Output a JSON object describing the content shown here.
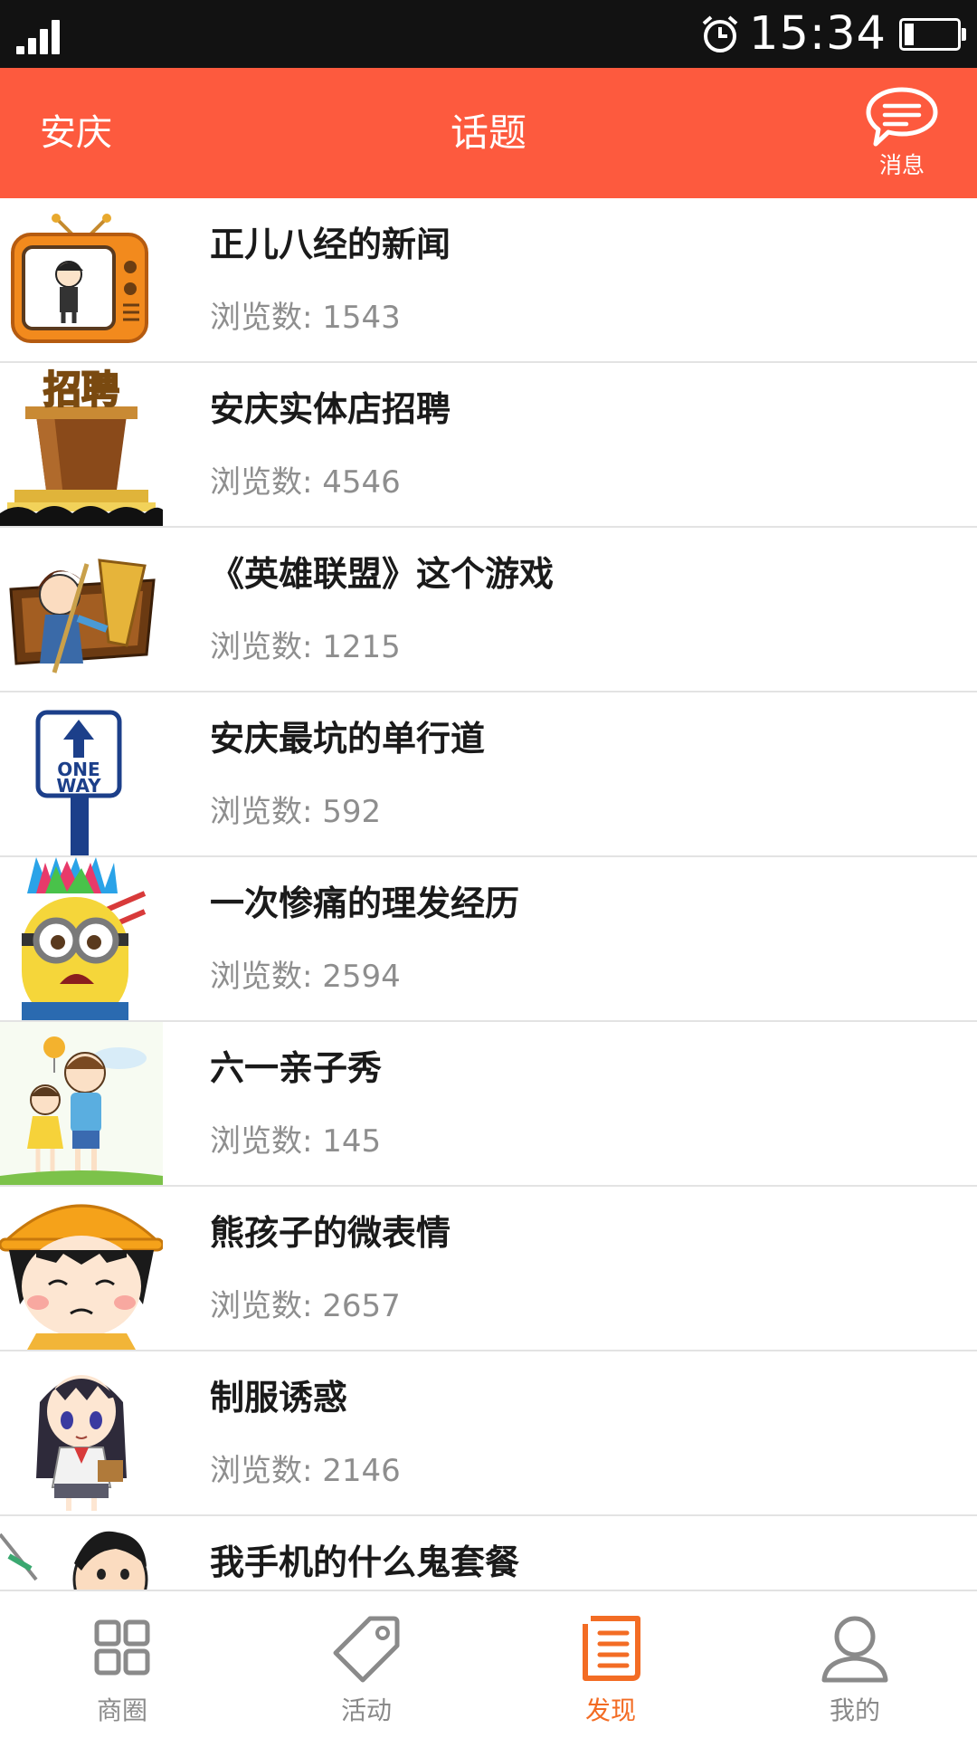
{
  "status_bar": {
    "time": "15:34"
  },
  "header": {
    "city": "安庆",
    "title": "话题",
    "message_label": "消息"
  },
  "topics": [
    {
      "title": "正儿八经的新闻",
      "views_label": "浏览数:",
      "views": "1543",
      "icon": "tv-cartoon-icon"
    },
    {
      "title": "安庆实体店招聘",
      "views_label": "浏览数:",
      "views": "4546",
      "icon": "recruit-podium-icon"
    },
    {
      "title": "《英雄联盟》这个游戏",
      "views_label": "浏览数:",
      "views": "1215",
      "icon": "game-hero-icon"
    },
    {
      "title": "安庆最坑的单行道",
      "views_label": "浏览数:",
      "views": "592",
      "icon": "one-way-sign-icon"
    },
    {
      "title": "一次惨痛的理发经历",
      "views_label": "浏览数:",
      "views": "2594",
      "icon": "minion-haircut-icon"
    },
    {
      "title": "六一亲子秀",
      "views_label": "浏览数:",
      "views": "145",
      "icon": "parent-child-icon"
    },
    {
      "title": "熊孩子的微表情",
      "views_label": "浏览数:",
      "views": "2657",
      "icon": "crying-girl-icon"
    },
    {
      "title": "制服诱惑",
      "views_label": "浏览数:",
      "views": "2146",
      "icon": "anime-girl-icon"
    },
    {
      "title": "我手机的什么鬼套餐",
      "views_label": "",
      "views": "",
      "icon": "cartoon-man-icon"
    }
  ],
  "sign_text": {
    "line1": "ONE",
    "line2": "WAY"
  },
  "recruit_text": "招聘",
  "tabs": [
    {
      "label": "商圈",
      "icon": "grid-icon",
      "active": false
    },
    {
      "label": "活动",
      "icon": "tag-icon",
      "active": false
    },
    {
      "label": "发现",
      "icon": "list-document-icon",
      "active": true
    },
    {
      "label": "我的",
      "icon": "person-icon",
      "active": false
    }
  ],
  "colors": {
    "header": "#fd5a3e",
    "active_tab": "#f36c24",
    "status_bar": "#121212"
  }
}
